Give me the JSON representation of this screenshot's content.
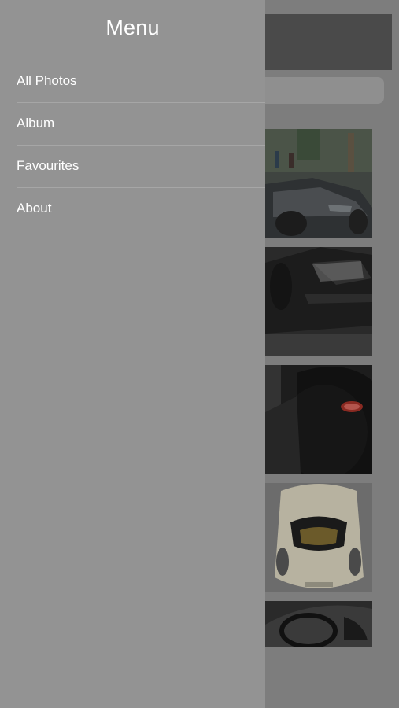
{
  "drawer": {
    "title": "Menu",
    "items": [
      {
        "label": "All Photos"
      },
      {
        "label": "Album"
      },
      {
        "label": "Favourites"
      },
      {
        "label": "About"
      }
    ]
  },
  "colors": {
    "drawer_bg": "#939393",
    "overlay_bg": "#7d7d7d",
    "header_bg": "#4a4a4a",
    "text": "#ffffff",
    "separator": "#a6a6a6"
  },
  "gallery": {
    "photos": [
      {
        "subject": "car-side-front-photo"
      },
      {
        "subject": "car-front-dark-photo"
      },
      {
        "subject": "car-grille-badge-photo"
      },
      {
        "subject": "car-top-view-photo"
      },
      {
        "subject": "car-interior-photo"
      }
    ]
  }
}
